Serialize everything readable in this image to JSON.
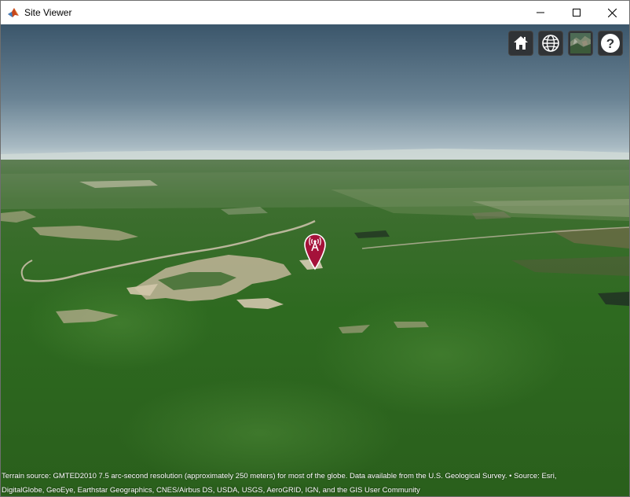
{
  "window": {
    "title": "Site Viewer",
    "app_icon": "matlab-icon",
    "controls": {
      "minimize": "minimize-icon",
      "maximize": "maximize-icon",
      "close": "close-icon"
    }
  },
  "toolbar": {
    "home": "home-icon",
    "scene_mode": "globe-icon",
    "base_layer": "imagery-layer-icon",
    "help": "help-icon",
    "help_glyph": "?"
  },
  "marker": {
    "icon": "antenna-marker-icon",
    "color": "#a5123a"
  },
  "attribution": {
    "line1": "Terrain source: GMTED2010 7.5 arc-second resolution (approximately 250 meters) for most of the globe. Data available from the U.S. Geological Survey. • Source: Esri,",
    "line2": "DigitalGlobe, GeoEye, Earthstar Geographics, CNES/Airbus DS, USDA, USGS, AeroGRID, IGN, and the GIS User Community"
  },
  "colors": {
    "sky_top": "#3d5a70",
    "sky_horizon": "#9fb2bd",
    "terrain": "#2f6a1f",
    "toolbar_bg": "#303336"
  }
}
